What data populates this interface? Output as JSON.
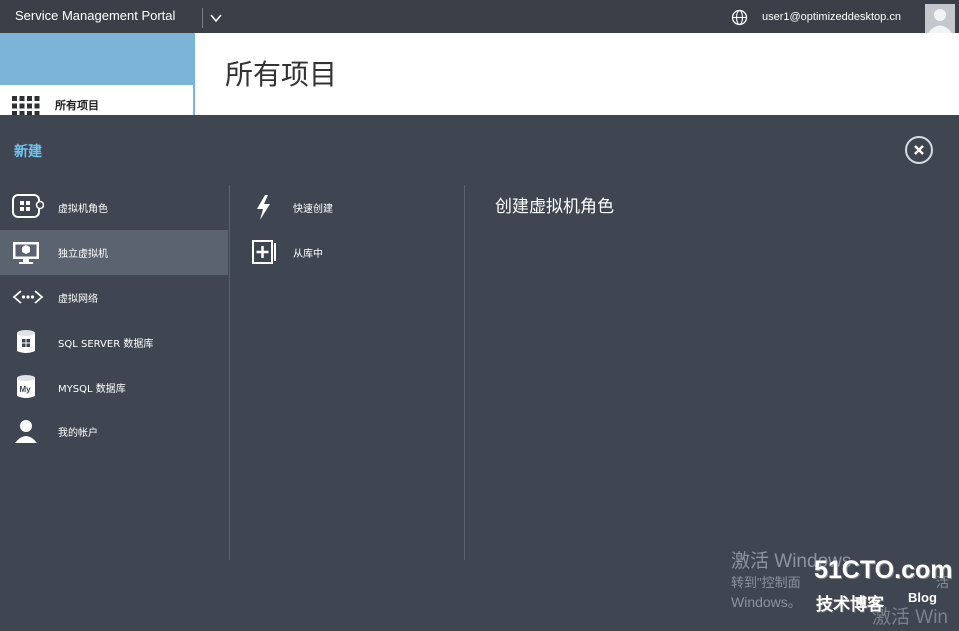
{
  "header": {
    "app_title": "Service Management Portal",
    "user_email": "user1@optimizeddesktop.cn",
    "icons": [
      "chevron-down-icon",
      "globe-icon",
      "avatar"
    ]
  },
  "sidebar": {
    "active_item": "所有项目"
  },
  "main": {
    "page_title": "所有项目"
  },
  "new_panel": {
    "title": "新建",
    "categories": [
      {
        "label": "虚拟机角色",
        "icon": "vm-role-icon",
        "selected": false
      },
      {
        "label": "独立虚拟机",
        "icon": "monitor-icon",
        "selected": true
      },
      {
        "label": "虚拟网络",
        "icon": "network-icon",
        "selected": false
      },
      {
        "label": "SQL SERVER 数据库",
        "icon": "sql-db-icon",
        "selected": false
      },
      {
        "label": "MYSQL 数据库",
        "icon": "mysql-db-icon",
        "selected": false
      },
      {
        "label": "我的帐户",
        "icon": "person-icon",
        "selected": false
      }
    ],
    "options": [
      {
        "label": "快速创建",
        "icon": "lightning-icon"
      },
      {
        "label": "从库中",
        "icon": "gallery-add-icon"
      }
    ],
    "detail_title": "创建虚拟机角色"
  },
  "watermark": {
    "line1": "激活 Windows",
    "line2": "转到\"控制面",
    "line2_end": "活",
    "line3": "Windows。",
    "line4": "激活 Win",
    "logo_main": "51CTO.com",
    "logo_sub": "技术博客",
    "logo_blog": "Blog"
  },
  "colors": {
    "accent": "#6fc3ef",
    "topbar": "#3b4048",
    "panel": "#3f4652",
    "selected": "#5b6371",
    "sidebar": "#7bb4d6"
  }
}
